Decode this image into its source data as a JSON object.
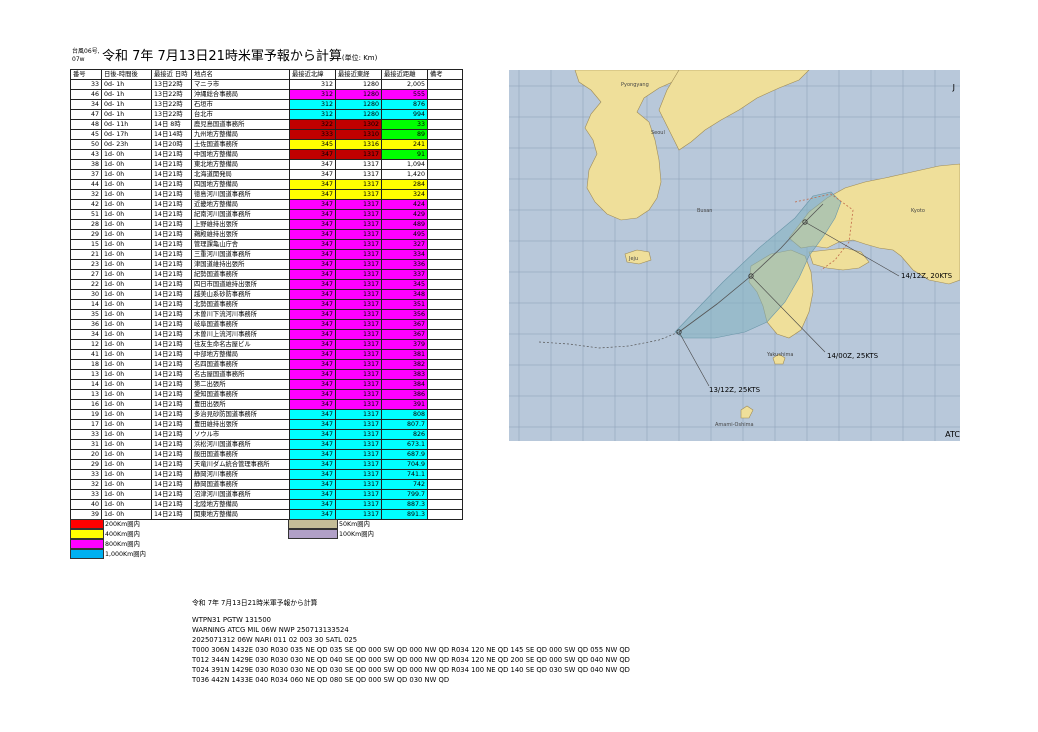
{
  "header": {
    "storm_label": "台風06号, 07w",
    "title": "令和 7年 7月13日21時米軍予報から計算",
    "unit": "(単位: Km)"
  },
  "table": {
    "columns": [
      "番号",
      "日後-時間後",
      "最接近 日時",
      "地点名",
      "最接近北緯",
      "最接近東経",
      "最接近距離",
      "備考"
    ],
    "rows": [
      {
        "no": "33",
        "after": "0d-  1h",
        "dt": "13日22時",
        "name": "マニラ市",
        "lat": "312",
        "lon": "1280",
        "dist": "2,005",
        "c_lat": "",
        "c_dist": ""
      },
      {
        "no": "46",
        "after": "0d-  1h",
        "dt": "13日22時",
        "name": "沖縄総合事務局",
        "lat": "312",
        "lon": "1280",
        "dist": "555",
        "c_lat": "bg-magenta",
        "c_dist": "bg-magenta"
      },
      {
        "no": "34",
        "after": "0d-  1h",
        "dt": "13日22時",
        "name": "石垣市",
        "lat": "312",
        "lon": "1280",
        "dist": "876",
        "c_lat": "bg-cyan",
        "c_dist": "bg-cyan"
      },
      {
        "no": "47",
        "after": "0d-  1h",
        "dt": "13日22時",
        "name": "台北市",
        "lat": "312",
        "lon": "1280",
        "dist": "994",
        "c_lat": "bg-cyan",
        "c_dist": "bg-cyan"
      },
      {
        "no": "48",
        "after": "0d- 11h",
        "dt": "14日  8時",
        "name": "鹿児島国道事務所",
        "lat": "322",
        "lon": "1302",
        "dist": "33",
        "c_lat": "bg-darkred",
        "c_dist": "bg-green"
      },
      {
        "no": "45",
        "after": "0d- 17h",
        "dt": "14日14時",
        "name": "九州地方整備局",
        "lat": "333",
        "lon": "1310",
        "dist": "89",
        "c_lat": "bg-darkred",
        "c_dist": "bg-green"
      },
      {
        "no": "50",
        "after": "0d- 23h",
        "dt": "14日20時",
        "name": "土佐国道事務所",
        "lat": "345",
        "lon": "1316",
        "dist": "241",
        "c_lat": "bg-yellow",
        "c_dist": "bg-yellow"
      },
      {
        "no": "43",
        "after": "1d-  0h",
        "dt": "14日21時",
        "name": "中国地方整備局",
        "lat": "347",
        "lon": "1317",
        "dist": "91",
        "c_lat": "bg-darkred",
        "c_dist": "bg-green"
      },
      {
        "no": "38",
        "after": "1d-  0h",
        "dt": "14日21時",
        "name": "東北地方整備局",
        "lat": "347",
        "lon": "1317",
        "dist": "1,094",
        "c_lat": "",
        "c_dist": ""
      },
      {
        "no": "37",
        "after": "1d-  0h",
        "dt": "14日21時",
        "name": "北海道開発局",
        "lat": "347",
        "lon": "1317",
        "dist": "1,420",
        "c_lat": "",
        "c_dist": ""
      },
      {
        "no": "44",
        "after": "1d-  0h",
        "dt": "14日21時",
        "name": "四国地方整備局",
        "lat": "347",
        "lon": "1317",
        "dist": "284",
        "c_lat": "bg-yellow",
        "c_dist": "bg-yellow"
      },
      {
        "no": "32",
        "after": "1d-  0h",
        "dt": "14日21時",
        "name": "徳島河川国道事務所",
        "lat": "347",
        "lon": "1317",
        "dist": "324",
        "c_lat": "bg-yellow",
        "c_dist": "bg-yellow"
      },
      {
        "no": "42",
        "after": "1d-  0h",
        "dt": "14日21時",
        "name": "近畿地方整備局",
        "lat": "347",
        "lon": "1317",
        "dist": "424",
        "c_lat": "bg-magenta",
        "c_dist": "bg-magenta"
      },
      {
        "no": "51",
        "after": "1d-  0h",
        "dt": "14日21時",
        "name": "紀南河川国道事務所",
        "lat": "347",
        "lon": "1317",
        "dist": "429",
        "c_lat": "bg-magenta",
        "c_dist": "bg-magenta"
      },
      {
        "no": "28",
        "after": "1d-  0h",
        "dt": "14日21時",
        "name": "上野維持出張所",
        "lat": "347",
        "lon": "1317",
        "dist": "489",
        "c_lat": "bg-magenta",
        "c_dist": "bg-magenta"
      },
      {
        "no": "29",
        "after": "1d-  0h",
        "dt": "14日21時",
        "name": "鵜殿維持出張所",
        "lat": "347",
        "lon": "1317",
        "dist": "495",
        "c_lat": "bg-magenta",
        "c_dist": "bg-magenta"
      },
      {
        "no": "15",
        "after": "1d-  0h",
        "dt": "14日21時",
        "name": "管理課亀山庁舎",
        "lat": "347",
        "lon": "1317",
        "dist": "327",
        "c_lat": "bg-magenta",
        "c_dist": "bg-magenta"
      },
      {
        "no": "21",
        "after": "1d-  0h",
        "dt": "14日21時",
        "name": "三重河川国道事務所",
        "lat": "347",
        "lon": "1317",
        "dist": "334",
        "c_lat": "bg-magenta",
        "c_dist": "bg-magenta"
      },
      {
        "no": "23",
        "after": "1d-  0h",
        "dt": "14日21時",
        "name": "津国道維持出張所",
        "lat": "347",
        "lon": "1317",
        "dist": "336",
        "c_lat": "bg-magenta",
        "c_dist": "bg-magenta"
      },
      {
        "no": "27",
        "after": "1d-  0h",
        "dt": "14日21時",
        "name": "紀勢国道事務所",
        "lat": "347",
        "lon": "1317",
        "dist": "337",
        "c_lat": "bg-magenta",
        "c_dist": "bg-magenta"
      },
      {
        "no": "22",
        "after": "1d-  0h",
        "dt": "14日21時",
        "name": "四日市国道維持出張所",
        "lat": "347",
        "lon": "1317",
        "dist": "345",
        "c_lat": "bg-magenta",
        "c_dist": "bg-magenta"
      },
      {
        "no": "30",
        "after": "1d-  0h",
        "dt": "14日21時",
        "name": "越美山系砂防事務所",
        "lat": "347",
        "lon": "1317",
        "dist": "348",
        "c_lat": "bg-magenta",
        "c_dist": "bg-magenta"
      },
      {
        "no": "14",
        "after": "1d-  0h",
        "dt": "14日21時",
        "name": "北勢国道事務所",
        "lat": "347",
        "lon": "1317",
        "dist": "351",
        "c_lat": "bg-magenta",
        "c_dist": "bg-magenta"
      },
      {
        "no": "35",
        "after": "1d-  0h",
        "dt": "14日21時",
        "name": "木曽川下流河川事務所",
        "lat": "347",
        "lon": "1317",
        "dist": "356",
        "c_lat": "bg-magenta",
        "c_dist": "bg-magenta"
      },
      {
        "no": "36",
        "after": "1d-  0h",
        "dt": "14日21時",
        "name": "岐阜国道事務所",
        "lat": "347",
        "lon": "1317",
        "dist": "367",
        "c_lat": "bg-magenta",
        "c_dist": "bg-magenta"
      },
      {
        "no": "34",
        "after": "1d-  0h",
        "dt": "14日21時",
        "name": "木曽川上流河川事務所",
        "lat": "347",
        "lon": "1317",
        "dist": "367",
        "c_lat": "bg-magenta",
        "c_dist": "bg-magenta"
      },
      {
        "no": "12",
        "after": "1d-  0h",
        "dt": "14日21時",
        "name": "住友生命名古屋ビル",
        "lat": "347",
        "lon": "1317",
        "dist": "379",
        "c_lat": "bg-magenta",
        "c_dist": "bg-magenta"
      },
      {
        "no": "41",
        "after": "1d-  0h",
        "dt": "14日21時",
        "name": "中部地方整備局",
        "lat": "347",
        "lon": "1317",
        "dist": "381",
        "c_lat": "bg-magenta",
        "c_dist": "bg-magenta"
      },
      {
        "no": "18",
        "after": "1d-  0h",
        "dt": "14日21時",
        "name": "名四国道事務所",
        "lat": "347",
        "lon": "1317",
        "dist": "382",
        "c_lat": "bg-magenta",
        "c_dist": "bg-magenta"
      },
      {
        "no": "13",
        "after": "1d-  0h",
        "dt": "14日21時",
        "name": "名古屋国道事務所",
        "lat": "347",
        "lon": "1317",
        "dist": "383",
        "c_lat": "bg-magenta",
        "c_dist": "bg-magenta"
      },
      {
        "no": "14",
        "after": "1d-  0h",
        "dt": "14日21時",
        "name": "第二出張所",
        "lat": "347",
        "lon": "1317",
        "dist": "384",
        "c_lat": "bg-magenta",
        "c_dist": "bg-magenta"
      },
      {
        "no": "13",
        "after": "1d-  0h",
        "dt": "14日21時",
        "name": "愛知国道事務所",
        "lat": "347",
        "lon": "1317",
        "dist": "386",
        "c_lat": "bg-magenta",
        "c_dist": "bg-magenta"
      },
      {
        "no": "16",
        "after": "1d-  0h",
        "dt": "14日21時",
        "name": "豊田出張所",
        "lat": "347",
        "lon": "1317",
        "dist": "391",
        "c_lat": "bg-magenta",
        "c_dist": "bg-magenta"
      },
      {
        "no": "19",
        "after": "1d-  0h",
        "dt": "14日21時",
        "name": "多治見砂防国道事務所",
        "lat": "347",
        "lon": "1317",
        "dist": "808",
        "c_lat": "bg-cyan",
        "c_dist": "bg-cyan"
      },
      {
        "no": "17",
        "after": "1d-  0h",
        "dt": "14日21時",
        "name": "豊田維持出張所",
        "lat": "347",
        "lon": "1317",
        "dist": "807.7",
        "c_lat": "bg-cyan",
        "c_dist": "bg-cyan"
      },
      {
        "no": "33",
        "after": "1d-  0h",
        "dt": "14日21時",
        "name": "ソウル市",
        "lat": "347",
        "lon": "1317",
        "dist": "826",
        "c_lat": "bg-cyan",
        "c_dist": "bg-cyan"
      },
      {
        "no": "31",
        "after": "1d-  0h",
        "dt": "14日21時",
        "name": "浜松河川国道事務所",
        "lat": "347",
        "lon": "1317",
        "dist": "673.1",
        "c_lat": "bg-cyan",
        "c_dist": "bg-cyan"
      },
      {
        "no": "20",
        "after": "1d-  0h",
        "dt": "14日21時",
        "name": "飯田国道事務所",
        "lat": "347",
        "lon": "1317",
        "dist": "687.9",
        "c_lat": "bg-cyan",
        "c_dist": "bg-cyan"
      },
      {
        "no": "29",
        "after": "1d-  0h",
        "dt": "14日21時",
        "name": "天竜川ダム統合管理事務所",
        "lat": "347",
        "lon": "1317",
        "dist": "704.9",
        "c_lat": "bg-cyan",
        "c_dist": "bg-cyan"
      },
      {
        "no": "33",
        "after": "1d-  0h",
        "dt": "14日21時",
        "name": "静岡河川事務所",
        "lat": "347",
        "lon": "1317",
        "dist": "741.1",
        "c_lat": "bg-cyan",
        "c_dist": "bg-cyan"
      },
      {
        "no": "32",
        "after": "1d-  0h",
        "dt": "14日21時",
        "name": "静岡国道事務所",
        "lat": "347",
        "lon": "1317",
        "dist": "742",
        "c_lat": "bg-cyan",
        "c_dist": "bg-cyan"
      },
      {
        "no": "33",
        "after": "1d-  0h",
        "dt": "14日21時",
        "name": "沼津河川国道事務所",
        "lat": "347",
        "lon": "1317",
        "dist": "799.7",
        "c_lat": "bg-cyan",
        "c_dist": "bg-cyan"
      },
      {
        "no": "40",
        "after": "1d-  0h",
        "dt": "14日21時",
        "name": "北陸地方整備局",
        "lat": "347",
        "lon": "1317",
        "dist": "887.3",
        "c_lat": "bg-cyan",
        "c_dist": "bg-cyan"
      },
      {
        "no": "39",
        "after": "1d-  0h",
        "dt": "14日21時",
        "name": "関東地方整備局",
        "lat": "347",
        "lon": "1317",
        "dist": "891.3",
        "c_lat": "bg-cyan",
        "c_dist": "bg-cyan"
      }
    ]
  },
  "legend": {
    "items": [
      {
        "label": "200Km圏内",
        "color": "#ff0000"
      },
      {
        "label": "400Km圏内",
        "color": "#ffff00"
      },
      {
        "label": "800Km圏内",
        "color": "#ff00ff"
      },
      {
        "label": "1,000Km圏内",
        "color": "#00b0f0"
      },
      {
        "label": "50Km圏内",
        "color": "#c4bd97"
      },
      {
        "label": "100Km圏内",
        "color": "#b1a0c7"
      }
    ]
  },
  "map": {
    "places": {
      "pyongyang": "Pyongyang",
      "seoul": "Seoul",
      "busan": "Busan",
      "jeju": "Jeju",
      "kyoto": "Kyoto",
      "amami": "Amami-Oshima",
      "yakushima": "Yakushima"
    },
    "labels": {
      "f1412": "14/12Z, 20KTS",
      "f1400": "14/00Z, 25KTS",
      "f1312": "13/12Z, 25KTS"
    },
    "corner_top": "J",
    "corner_bottom": "ATC"
  },
  "bulletin": {
    "title": "令和 7年 7月13日21時米軍予報から計算",
    "lines": [
      "WTPN31 PGTW 131500",
      "WARNING    ATCG MIL 06W NWP 250713133524",
      "2025071312 06W NARI        011  02 003 30 SATL 025",
      "T000 306N 1432E 030 R030 035 NE QD 035 SE QD 000 SW QD 000 NW QD R034 120 NE QD 145 SE QD 000 SW QD 055 NW QD",
      "T012 344N 1429E 030 R030 030 NE QD 040 SE QD 000 SW QD 000 NW QD R034 120 NE QD 200 SE QD 000 SW QD 040 NW QD",
      "T024 391N 1429E 030 R030 030 NE QD 030 SE QD 000 SW QD 000 NW QD R034 100 NE QD 140 SE QD 030 SW QD 040 NW QD",
      "T036 442N 1433E 040 R034 060 NE QD 080 SE QD 000 SW QD 030 NW QD"
    ]
  }
}
